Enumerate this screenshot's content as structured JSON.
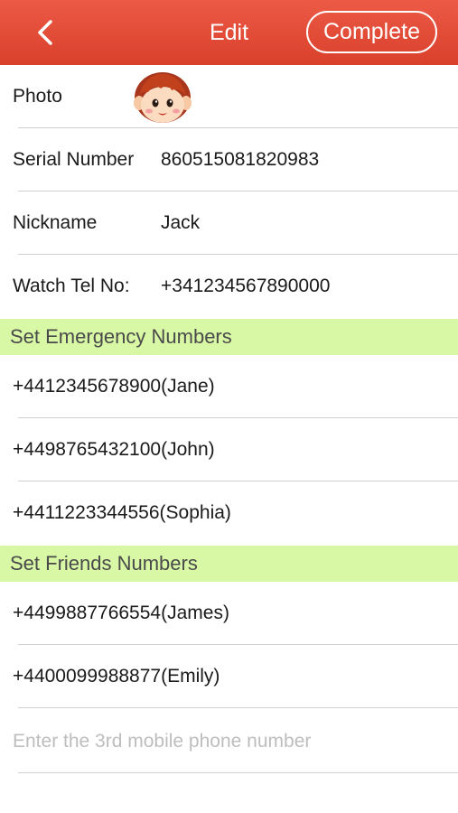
{
  "navbar": {
    "title": "Edit",
    "complete_label": "Complete",
    "back_icon": "chevron-left-icon",
    "color": "#e04a35"
  },
  "profile": {
    "photo_label": "Photo",
    "avatar_icon": "cartoon-boy-avatar",
    "serial_label": "Serial Number",
    "serial_value": "860515081820983",
    "nickname_label": "Nickname",
    "nickname_value": "Jack",
    "tel_label": "Watch Tel No:",
    "tel_value": "+341234567890000"
  },
  "emergency": {
    "header": "Set Emergency Numbers",
    "items": [
      "+4412345678900(Jane)",
      "+4498765432100(John)",
      "+4411223344556(Sophia)"
    ]
  },
  "friends": {
    "header": "Set Friends Numbers",
    "items": [
      "+4499887766554(James)",
      "+4400099988877(Emily)"
    ],
    "input_placeholder": "Enter the 3rd mobile phone number",
    "input_value": ""
  },
  "colors": {
    "section_bg": "#d8f8a6",
    "separator": "#cfcfcf"
  }
}
